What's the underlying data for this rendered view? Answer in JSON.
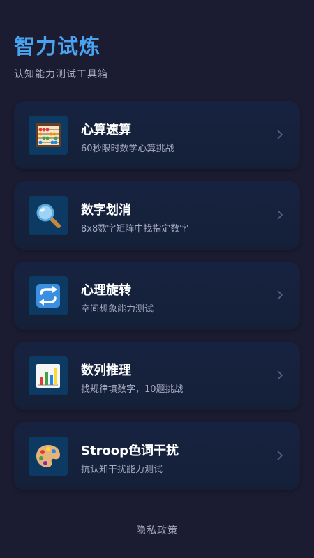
{
  "header": {
    "title": "智力试炼",
    "subtitle": "认知能力测试工具箱"
  },
  "cards": [
    {
      "title": "心算速算",
      "desc": "60秒限时数学心算挑战",
      "icon": "abacus-icon"
    },
    {
      "title": "数字划消",
      "desc": "8x8数字矩阵中找指定数字",
      "icon": "magnifier-icon"
    },
    {
      "title": "心理旋转",
      "desc": "空间想象能力测试",
      "icon": "rotate-arrows-icon"
    },
    {
      "title": "数列推理",
      "desc": "找规律填数字，10题挑战",
      "icon": "bar-chart-icon"
    },
    {
      "title": "Stroop色词干扰",
      "desc": "抗认知干扰能力测试",
      "icon": "palette-icon"
    }
  ],
  "footer": {
    "privacy_label": "隐私政策"
  },
  "colors": {
    "background": "#1b1c31",
    "title_accent": "#4aa3f0",
    "card_background": "#162240"
  }
}
